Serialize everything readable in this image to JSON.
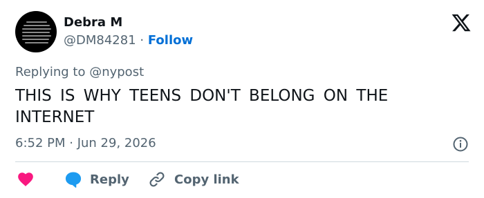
{
  "user": {
    "name": "Debra M",
    "handle": "@DM84281",
    "separator": "·",
    "follow_label": "Follow"
  },
  "tweet": {
    "reply_to": "Replying to @nypost",
    "text": "THIS IS WHY TEENS DON'T BELONG ON THE INTERNET",
    "timestamp": "6:52 PM · Jun 29, 2026"
  },
  "actions": {
    "like_icon": "heart-icon",
    "reply_label": "Reply",
    "copy_link_label": "Copy link"
  },
  "colors": {
    "follow": "#006fd6",
    "like": "#f91880",
    "reply_bubble": "#1d9bf0",
    "muted": "#536471"
  }
}
